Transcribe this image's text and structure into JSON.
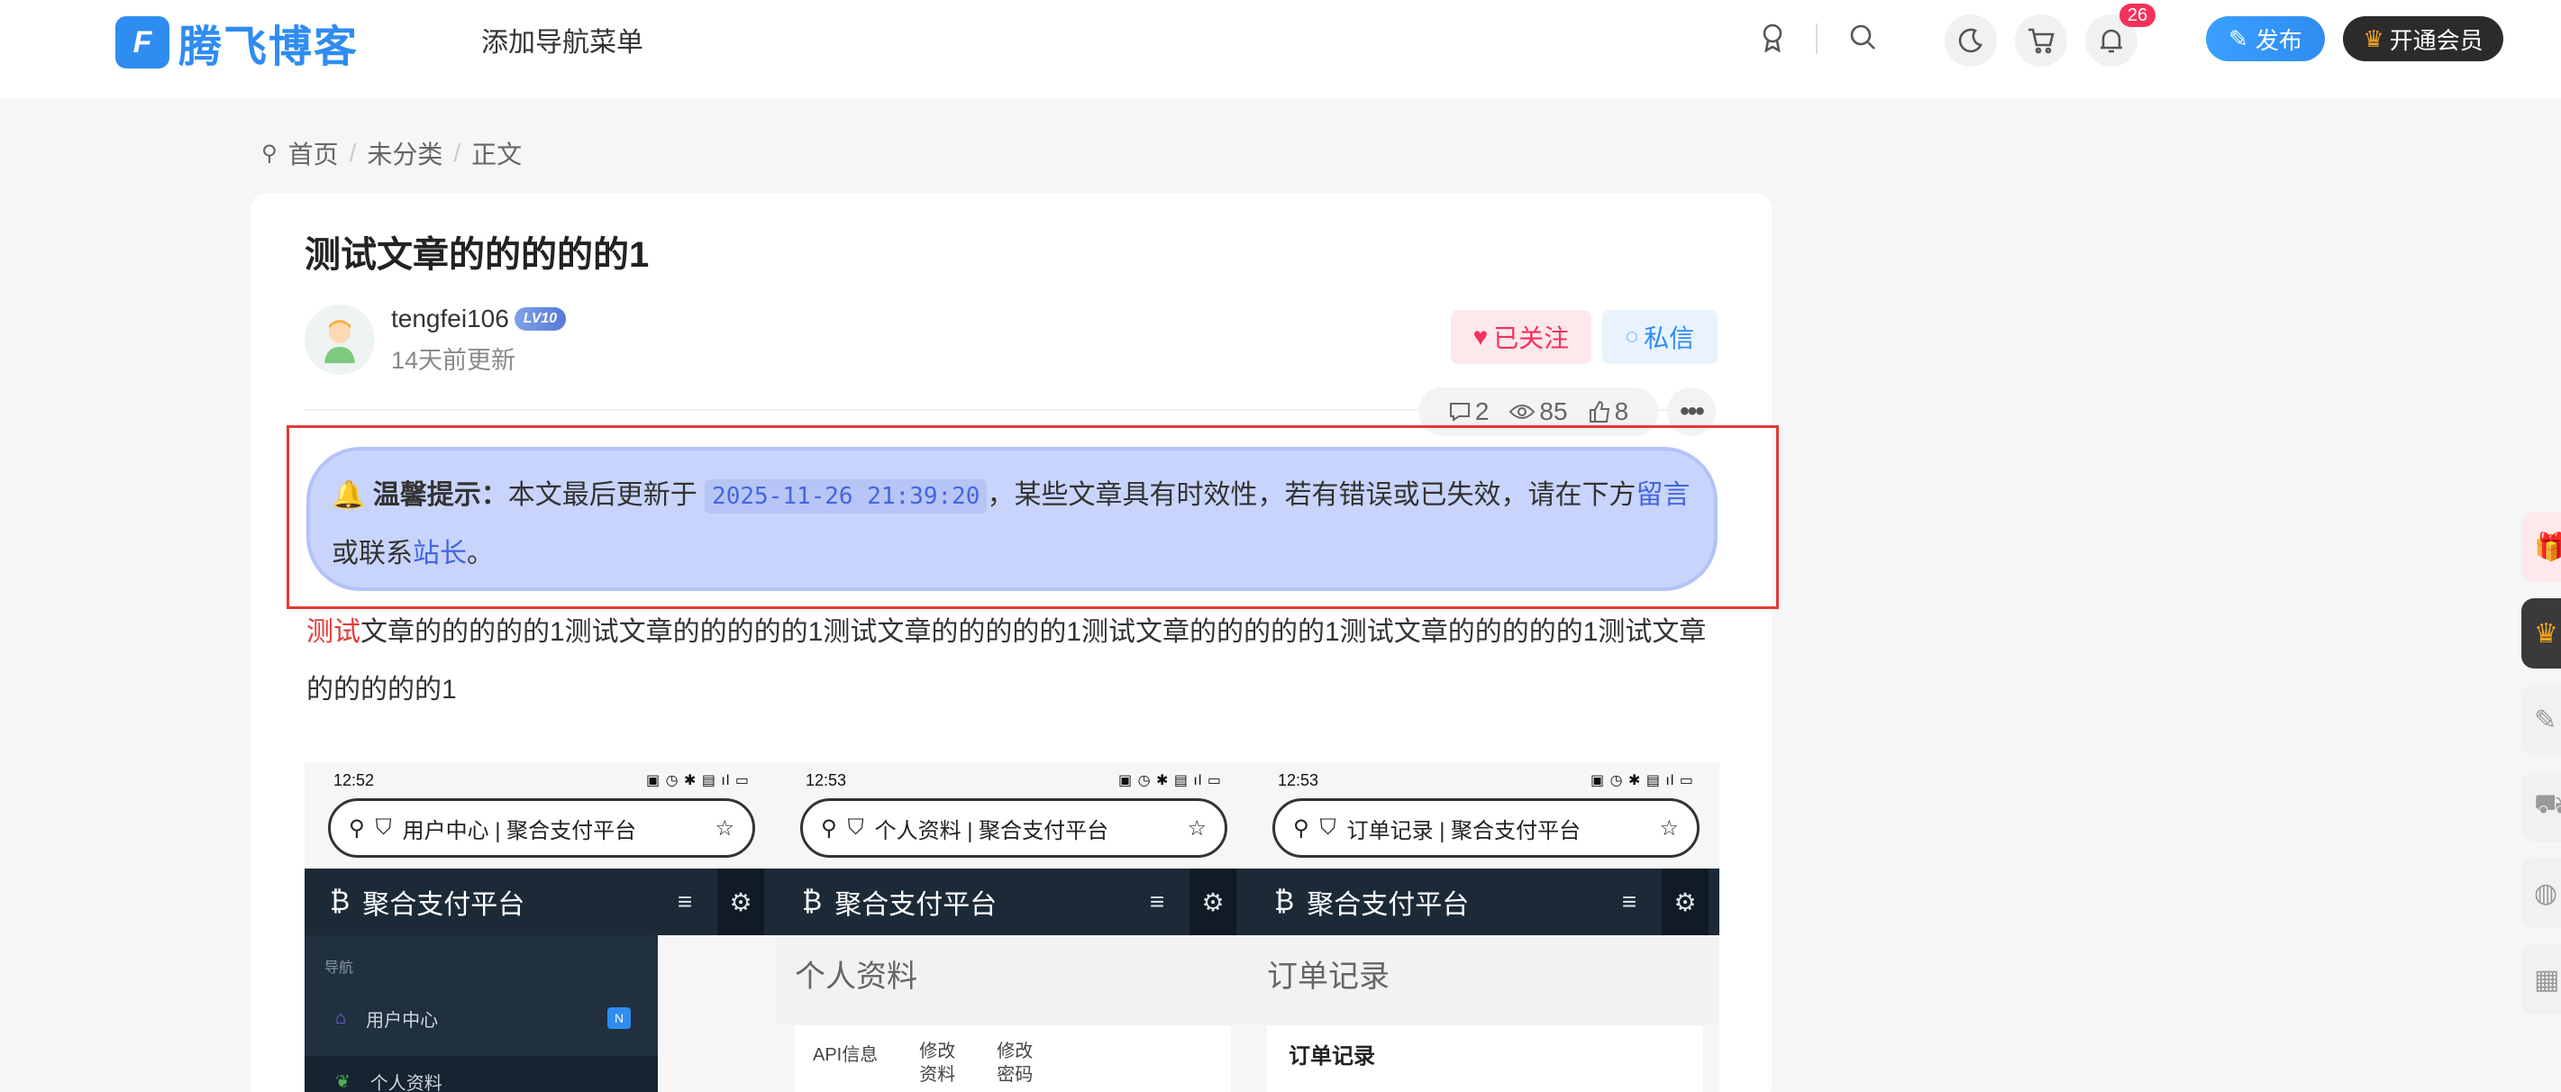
{
  "header": {
    "logo_mark": "F",
    "logo_text": "腾飞博客",
    "nav_menu": "添加导航菜单",
    "notification_count": "26",
    "publish_label": "发布",
    "vip_label": "开通会员"
  },
  "breadcrumb": {
    "home": "首页",
    "category": "未分类",
    "current": "正文"
  },
  "article": {
    "title": "测试文章的的的的的1",
    "author": "tengfei106",
    "level": "LV10",
    "updated": "14天前更新",
    "follow_label": "已关注",
    "message_label": "私信",
    "comments": "2",
    "views": "85",
    "likes": "8",
    "tip_label": "温馨提示：",
    "tip_text1": "本文最后更新于",
    "tip_time": "2025-11-26 21:39:20",
    "tip_text2": "，某些文章具有时效性，若有错误或已失效，请在下方",
    "tip_link1": "留言",
    "tip_text3": "或联系",
    "tip_link2": "站长",
    "tip_text4": "。",
    "body_highlight": "测试",
    "body_rest": "文章的的的的的1测试文章的的的的的1测试文章的的的的的1测试文章的的的的的1测试文章的的的的的1测试文章的的的的的1"
  },
  "screenshots": [
    {
      "time": "12:52",
      "url_title": "用户中心 | 聚合支付平台",
      "app_name": "聚合支付平台",
      "type": "menu",
      "nav_header": "导航",
      "items": [
        "用户中心",
        "个人资料"
      ],
      "new_badge": "N"
    },
    {
      "time": "12:53",
      "url_title": "个人资料 | 聚合支付平台",
      "app_name": "聚合支付平台",
      "type": "tabs",
      "page_title": "个人资料",
      "tabs": [
        "API信息",
        "修改资料",
        "修改密码"
      ]
    },
    {
      "time": "12:53",
      "url_title": "订单记录 | 聚合支付平台",
      "app_name": "聚合支付平台",
      "type": "panel",
      "page_title": "订单记录",
      "panel_title": "订单记录"
    }
  ],
  "colors": {
    "brand": "#2f8cf0",
    "accent_red": "#f5315b",
    "tip_bg": "#c8d4fb",
    "highlight_border": "#e53935"
  }
}
